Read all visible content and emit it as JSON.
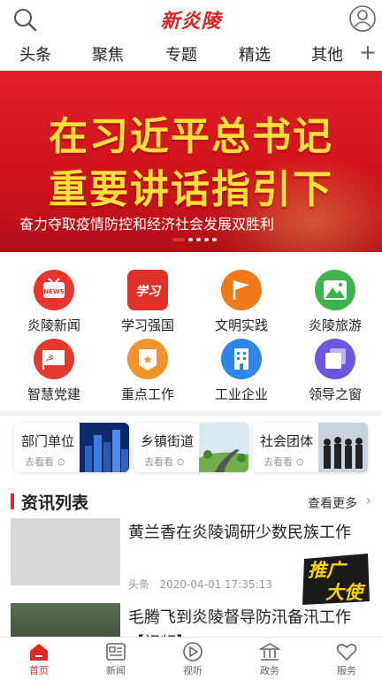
{
  "header": {
    "logo": "新炎陵",
    "tabs": [
      "头条",
      "聚焦",
      "专题",
      "精选",
      "其他"
    ],
    "add_tab": "+"
  },
  "banner": {
    "headline_line1": "在习近平总书记",
    "headline_line2": "重要讲话指引下",
    "subline": "奋力夺取疫情防控和经济社会发展双胜利",
    "slide_count": 5,
    "active_slide": 1
  },
  "grid": {
    "items": [
      {
        "label": "炎陵新闻",
        "icon": "tv-news-icon",
        "color": "#e8352d"
      },
      {
        "label": "学习强国",
        "icon": "xuexi-icon",
        "color": "#e0312b"
      },
      {
        "label": "文明实践",
        "icon": "flag-icon",
        "color": "#f07a1a"
      },
      {
        "label": "炎陵旅游",
        "icon": "mountain-icon",
        "color": "#3cb44a"
      },
      {
        "label": "智慧党建",
        "icon": "party-flag-icon",
        "color": "#e23a2f"
      },
      {
        "label": "重点工作",
        "icon": "star-badge-icon",
        "color": "#f0932a"
      },
      {
        "label": "工业企业",
        "icon": "building-icon",
        "color": "#2f86e6"
      },
      {
        "label": "领导之窗",
        "icon": "window-icon",
        "color": "#6d56e0"
      }
    ]
  },
  "cards": [
    {
      "title": "部门单位",
      "more": "去看看"
    },
    {
      "title": "乡镇街道",
      "more": "去看看"
    },
    {
      "title": "社会团体",
      "more": "去看看"
    }
  ],
  "news": {
    "title": "资讯列表",
    "more": "查看更多",
    "items": [
      {
        "title": "黄兰香在炎陵调研少数民族工作",
        "source": "头条",
        "time": "2020-04-01 17:35:13"
      },
      {
        "title": "毛腾飞到炎陵督导防汛备汛工作【视频】",
        "source": "",
        "time": ""
      }
    ]
  },
  "promo": {
    "text1": "推广",
    "text2": "大使"
  },
  "bottom_nav": [
    {
      "label": "首页",
      "icon": "home-icon",
      "active": true
    },
    {
      "label": "新闻",
      "icon": "newspaper-icon",
      "active": false
    },
    {
      "label": "视听",
      "icon": "play-icon",
      "active": false
    },
    {
      "label": "政务",
      "icon": "government-icon",
      "active": false
    },
    {
      "label": "服务",
      "icon": "heart-icon",
      "active": false
    }
  ],
  "colors": {
    "accent": "#e22a22",
    "banner_text": "#ffe03a"
  }
}
